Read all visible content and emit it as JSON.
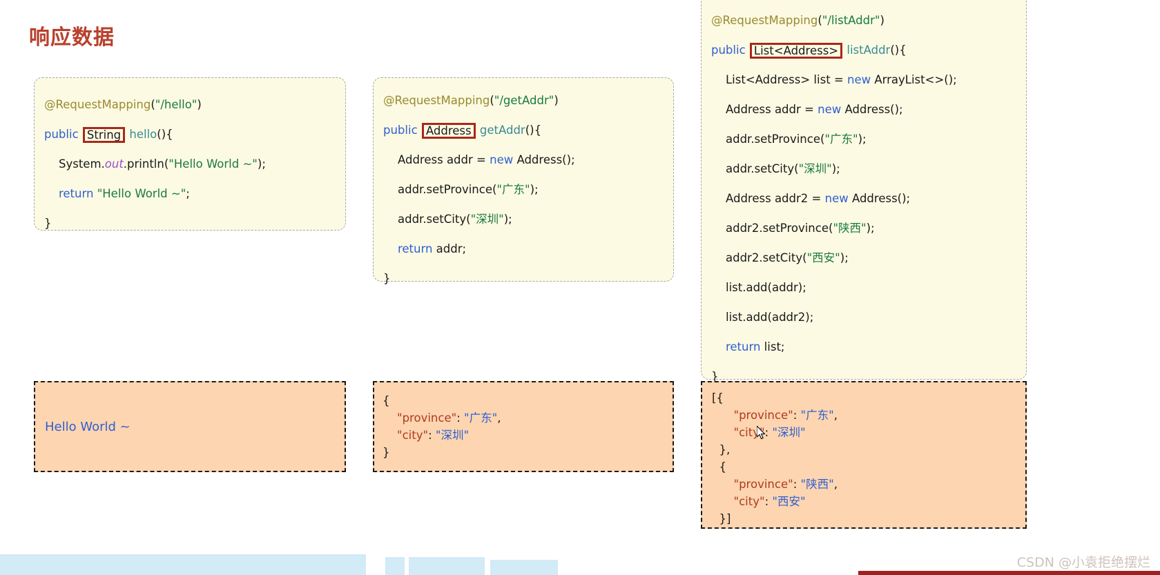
{
  "page": {
    "title": "响应数据",
    "title_color": "#b8402c",
    "background": "#ffffff"
  },
  "theme": {
    "code_bg": "#fcfae3",
    "code_border": "#a8a8a8",
    "output_bg": "#fdd5b0",
    "output_border": "#1a1a1a",
    "highlight_box": "#a8281a",
    "keyword": "#2f5fd0",
    "string": "#1a7a3c",
    "annotation": "#9a8a2f",
    "method": "#3b8a92",
    "field": "#9a4fd0",
    "json_key": "#b03a22",
    "json_value": "#2f5fd0",
    "wave": "#d3eaf7",
    "bottom_bar": "#a02020"
  },
  "code_blocks": [
    {
      "id": "hello",
      "highlight_type": "String",
      "lines": [
        {
          "indent": 0,
          "tokens": [
            {
              "t": "@RequestMapping",
              "c": "anno"
            },
            {
              "t": "(",
              "c": "plain"
            },
            {
              "t": "\"/hello\"",
              "c": "str"
            },
            {
              "t": ")",
              "c": "plain"
            }
          ]
        },
        {
          "indent": 0,
          "tokens": [
            {
              "t": "public",
              "c": "kw"
            },
            {
              "t": " ",
              "c": "plain"
            },
            {
              "t": "String",
              "c": "plain",
              "hl": true
            },
            {
              "t": " ",
              "c": "plain"
            },
            {
              "t": "hello",
              "c": "meth"
            },
            {
              "t": "(){",
              "c": "plain"
            }
          ]
        },
        {
          "indent": 1,
          "tokens": [
            {
              "t": "System.",
              "c": "plain"
            },
            {
              "t": "out",
              "c": "fld"
            },
            {
              "t": ".println(",
              "c": "plain"
            },
            {
              "t": "\"Hello World ~\"",
              "c": "str"
            },
            {
              "t": ");",
              "c": "plain"
            }
          ]
        },
        {
          "indent": 1,
          "tokens": [
            {
              "t": "return",
              "c": "kw"
            },
            {
              "t": " ",
              "c": "plain"
            },
            {
              "t": "\"Hello World ~\"",
              "c": "str"
            },
            {
              "t": ";",
              "c": "plain"
            }
          ]
        },
        {
          "indent": 0,
          "tokens": [
            {
              "t": "}",
              "c": "plain"
            }
          ]
        }
      ]
    },
    {
      "id": "getAddr",
      "highlight_type": "Address",
      "lines": [
        {
          "indent": 0,
          "tokens": [
            {
              "t": "@RequestMapping",
              "c": "anno"
            },
            {
              "t": "(",
              "c": "plain"
            },
            {
              "t": "\"/getAddr\"",
              "c": "str"
            },
            {
              "t": ")",
              "c": "plain"
            }
          ]
        },
        {
          "indent": 0,
          "tokens": [
            {
              "t": "public",
              "c": "kw"
            },
            {
              "t": " ",
              "c": "plain"
            },
            {
              "t": "Address",
              "c": "plain",
              "hl": true
            },
            {
              "t": " ",
              "c": "plain"
            },
            {
              "t": "getAddr",
              "c": "meth"
            },
            {
              "t": "(){",
              "c": "plain"
            }
          ]
        },
        {
          "indent": 1,
          "tokens": [
            {
              "t": "Address addr = ",
              "c": "plain"
            },
            {
              "t": "new",
              "c": "kw"
            },
            {
              "t": " Address();",
              "c": "plain"
            }
          ]
        },
        {
          "indent": 1,
          "tokens": [
            {
              "t": "addr.setProvince(",
              "c": "plain"
            },
            {
              "t": "\"广东\"",
              "c": "str"
            },
            {
              "t": ");",
              "c": "plain"
            }
          ]
        },
        {
          "indent": 1,
          "tokens": [
            {
              "t": "addr.setCity(",
              "c": "plain"
            },
            {
              "t": "\"深圳\"",
              "c": "str"
            },
            {
              "t": ");",
              "c": "plain"
            }
          ]
        },
        {
          "indent": 1,
          "tokens": [
            {
              "t": "return",
              "c": "kw"
            },
            {
              "t": " addr;",
              "c": "plain"
            }
          ]
        },
        {
          "indent": 0,
          "tokens": [
            {
              "t": "}",
              "c": "plain"
            }
          ]
        }
      ]
    },
    {
      "id": "listAddr",
      "highlight_type": "List<Address>",
      "lines": [
        {
          "indent": 0,
          "tokens": [
            {
              "t": "@RequestMapping",
              "c": "anno"
            },
            {
              "t": "(",
              "c": "plain"
            },
            {
              "t": "\"/listAddr\"",
              "c": "str"
            },
            {
              "t": ")",
              "c": "plain"
            }
          ]
        },
        {
          "indent": 0,
          "tokens": [
            {
              "t": "public",
              "c": "kw"
            },
            {
              "t": " ",
              "c": "plain"
            },
            {
              "t": "List<Address>",
              "c": "plain",
              "hl": true
            },
            {
              "t": " ",
              "c": "plain"
            },
            {
              "t": "listAddr",
              "c": "meth"
            },
            {
              "t": "(){",
              "c": "plain"
            }
          ]
        },
        {
          "indent": 1,
          "tokens": [
            {
              "t": "List<Address> list = ",
              "c": "plain"
            },
            {
              "t": "new",
              "c": "kw"
            },
            {
              "t": " ArrayList<>();",
              "c": "plain"
            }
          ]
        },
        {
          "indent": 1,
          "tokens": [
            {
              "t": "Address addr = ",
              "c": "plain"
            },
            {
              "t": "new",
              "c": "kw"
            },
            {
              "t": " Address();",
              "c": "plain"
            }
          ]
        },
        {
          "indent": 1,
          "tokens": [
            {
              "t": "addr.setProvince(",
              "c": "plain"
            },
            {
              "t": "\"广东\"",
              "c": "str"
            },
            {
              "t": ");",
              "c": "plain"
            }
          ]
        },
        {
          "indent": 1,
          "tokens": [
            {
              "t": "addr.setCity(",
              "c": "plain"
            },
            {
              "t": "\"深圳\"",
              "c": "str"
            },
            {
              "t": ");",
              "c": "plain"
            }
          ]
        },
        {
          "indent": 1,
          "tokens": [
            {
              "t": "Address addr2 = ",
              "c": "plain"
            },
            {
              "t": "new",
              "c": "kw"
            },
            {
              "t": " Address();",
              "c": "plain"
            }
          ]
        },
        {
          "indent": 1,
          "tokens": [
            {
              "t": "addr2.setProvince(",
              "c": "plain"
            },
            {
              "t": "\"陕西\"",
              "c": "str"
            },
            {
              "t": ");",
              "c": "plain"
            }
          ]
        },
        {
          "indent": 1,
          "tokens": [
            {
              "t": "addr2.setCity(",
              "c": "plain"
            },
            {
              "t": "\"西安\"",
              "c": "str"
            },
            {
              "t": ");",
              "c": "plain"
            }
          ]
        },
        {
          "indent": 1,
          "tokens": [
            {
              "t": "list.add(addr);",
              "c": "plain"
            }
          ]
        },
        {
          "indent": 1,
          "tokens": [
            {
              "t": "list.add(addr2);",
              "c": "plain"
            }
          ]
        },
        {
          "indent": 1,
          "tokens": [
            {
              "t": "return",
              "c": "kw"
            },
            {
              "t": " list;",
              "c": "plain"
            }
          ]
        },
        {
          "indent": 0,
          "tokens": [
            {
              "t": "}",
              "c": "plain"
            }
          ]
        }
      ]
    }
  ],
  "outputs": [
    {
      "id": "hello-output",
      "kind": "text",
      "text": "Hello World ~"
    },
    {
      "id": "getAddr-output",
      "kind": "json",
      "lines": [
        {
          "tokens": [
            {
              "t": "{",
              "c": "jpunct"
            }
          ]
        },
        {
          "tokens": [
            {
              "t": "    ",
              "c": "jpunct"
            },
            {
              "t": "\"province\"",
              "c": "jkey"
            },
            {
              "t": ": ",
              "c": "jpunct"
            },
            {
              "t": "\"广东\"",
              "c": "jval"
            },
            {
              "t": ",",
              "c": "jpunct"
            }
          ]
        },
        {
          "tokens": [
            {
              "t": "    ",
              "c": "jpunct"
            },
            {
              "t": "\"city\"",
              "c": "jkey"
            },
            {
              "t": ": ",
              "c": "jpunct"
            },
            {
              "t": "\"深圳\"",
              "c": "jval"
            }
          ]
        },
        {
          "tokens": [
            {
              "t": "}",
              "c": "jpunct"
            }
          ]
        }
      ]
    },
    {
      "id": "listAddr-output",
      "kind": "json",
      "lines": [
        {
          "tokens": [
            {
              "t": "[{",
              "c": "jpunct"
            }
          ]
        },
        {
          "tokens": [
            {
              "t": "      ",
              "c": "jpunct"
            },
            {
              "t": "\"province\"",
              "c": "jkey"
            },
            {
              "t": ": ",
              "c": "jpunct"
            },
            {
              "t": "\"广东\"",
              "c": "jval"
            },
            {
              "t": ",",
              "c": "jpunct"
            }
          ]
        },
        {
          "tokens": [
            {
              "t": "      ",
              "c": "jpunct"
            },
            {
              "t": "\"city\"",
              "c": "jkey"
            },
            {
              "t": ": ",
              "c": "jpunct"
            },
            {
              "t": "\"深圳\"",
              "c": "jval"
            }
          ]
        },
        {
          "tokens": [
            {
              "t": "  },",
              "c": "jpunct"
            }
          ]
        },
        {
          "tokens": [
            {
              "t": "  {",
              "c": "jpunct"
            }
          ]
        },
        {
          "tokens": [
            {
              "t": "      ",
              "c": "jpunct"
            },
            {
              "t": "\"province\"",
              "c": "jkey"
            },
            {
              "t": ": ",
              "c": "jpunct"
            },
            {
              "t": "\"陕西\"",
              "c": "jval"
            },
            {
              "t": ",",
              "c": "jpunct"
            }
          ]
        },
        {
          "tokens": [
            {
              "t": "      ",
              "c": "jpunct"
            },
            {
              "t": "\"city\"",
              "c": "jkey"
            },
            {
              "t": ": ",
              "c": "jpunct"
            },
            {
              "t": "\"西安\"",
              "c": "jval"
            }
          ]
        },
        {
          "tokens": [
            {
              "t": "  }]",
              "c": "jpunct"
            }
          ]
        }
      ]
    }
  ],
  "watermark": {
    "text": "CSDN @小袁拒绝摆烂"
  }
}
